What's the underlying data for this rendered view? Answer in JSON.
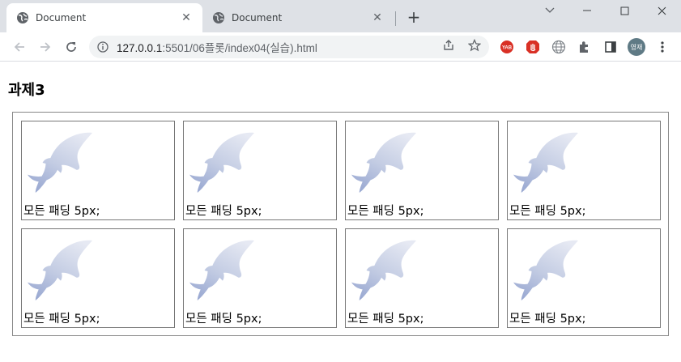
{
  "browser": {
    "tabs": [
      {
        "title": "Document",
        "active": true
      },
      {
        "title": "Document",
        "active": false
      }
    ],
    "url_host": "127.0.0.1",
    "url_rest": ":5501/06플롯/index04(실습).html",
    "avatar_label": "영재",
    "colors": {
      "chrome_bg": "#dee1e6",
      "omnibox_bg": "#f1f3f4"
    }
  },
  "page": {
    "heading": "과제3",
    "cards": [
      {
        "caption": "모든 패딩 5px;"
      },
      {
        "caption": "모든 패딩 5px;"
      },
      {
        "caption": "모든 패딩 5px;"
      },
      {
        "caption": "모든 패딩 5px;"
      },
      {
        "caption": "모든 패딩 5px;"
      },
      {
        "caption": "모든 패딩 5px;"
      },
      {
        "caption": "모든 패딩 5px;"
      },
      {
        "caption": "모든 패딩 5px;"
      }
    ],
    "image_icon": "fish-image"
  }
}
